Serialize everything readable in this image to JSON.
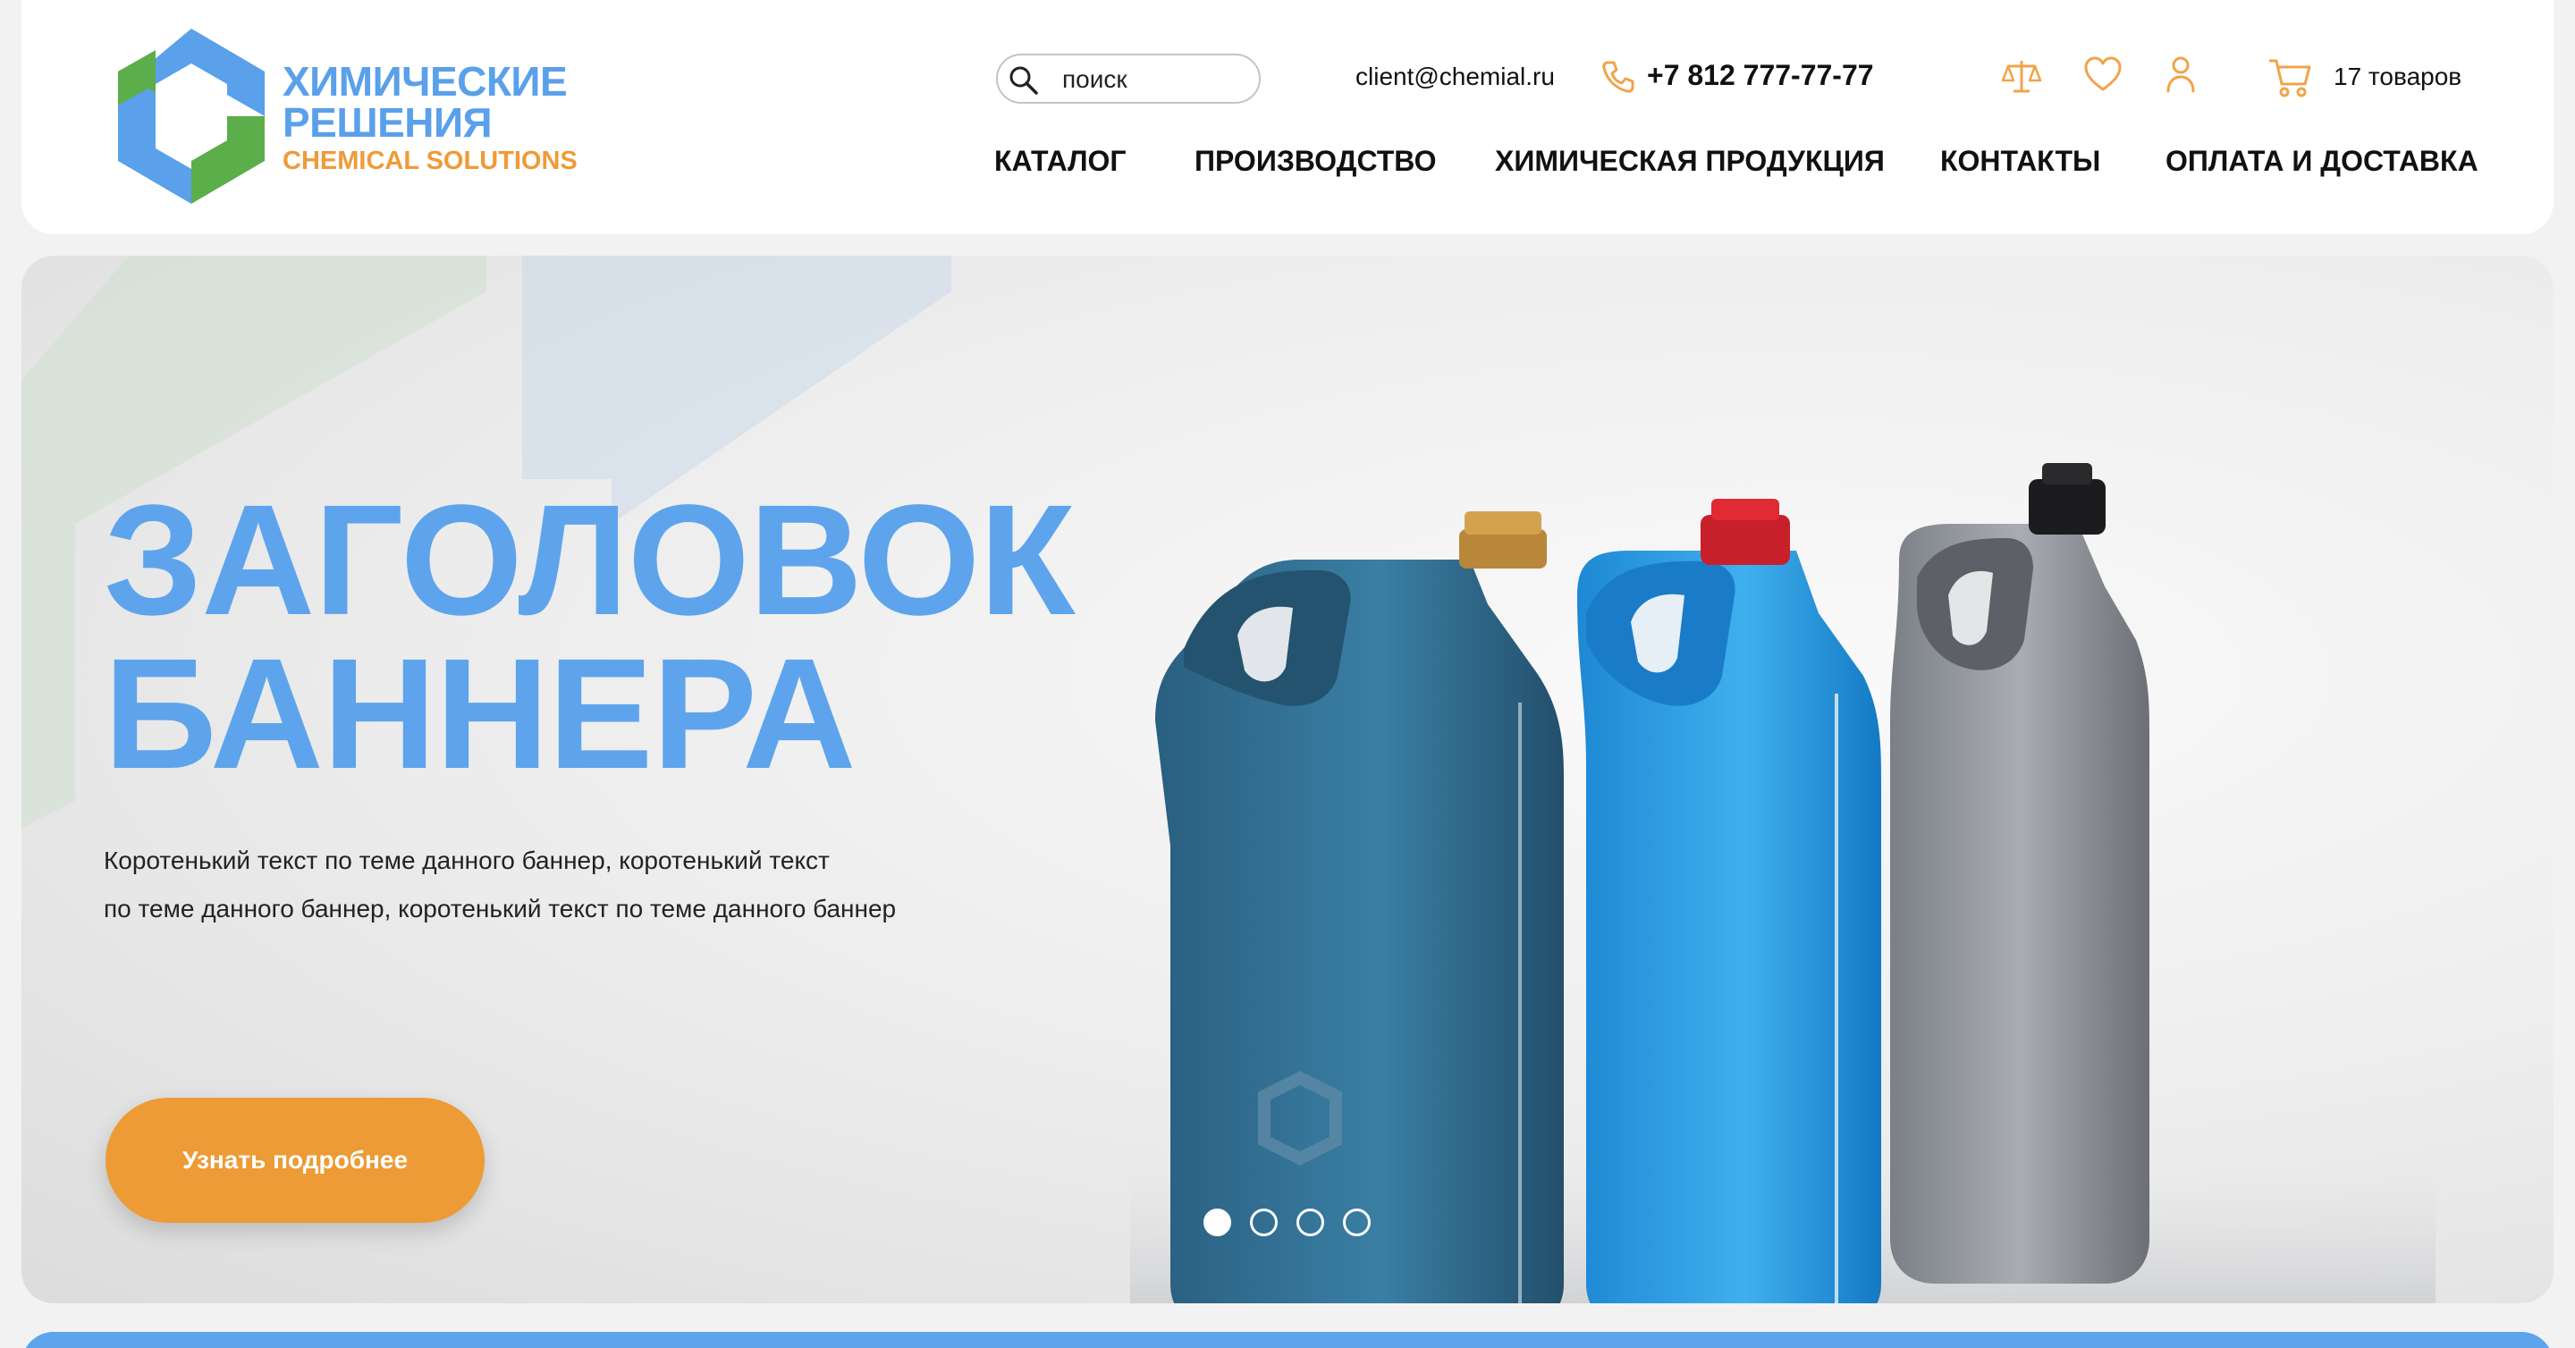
{
  "header": {
    "logo": {
      "line1": "ХИМИЧЕСКИЕ",
      "line2": "РЕШЕНИЯ",
      "line3": "CHEMICAL SOLUTIONS"
    },
    "search": {
      "placeholder": "поиск"
    },
    "email": "client@chemial.ru",
    "phone": "+7 812 777-77-77",
    "cart": {
      "text": "17 товаров"
    },
    "icons": [
      "compare-icon",
      "heart-icon",
      "user-icon",
      "cart-icon",
      "phone-icon",
      "search-icon"
    ],
    "nav": [
      "КАТАЛОГ",
      "ПРОИЗВОДСТВО",
      "ХИМИЧЕСКАЯ ПРОДУКЦИЯ",
      "КОНТАКТЫ",
      "ОПЛАТА И ДОСТАВКА"
    ]
  },
  "banner": {
    "headline_line1": "ЗАГОЛОВОК",
    "headline_line2": "БАННЕРА",
    "text_line1": "Коротенький текст по теме данного баннер, коротенький текст",
    "text_line2": "по теме данного баннер, коротенький текст по теме данного баннер",
    "button": "Узнать подробнее",
    "slides_total": 4,
    "active_slide": 1
  },
  "colors": {
    "brand_blue": "#5ea4ec",
    "brand_orange": "#ed9b36",
    "brand_green": "#5cae4a",
    "icon_orange": "#f0a44a"
  }
}
